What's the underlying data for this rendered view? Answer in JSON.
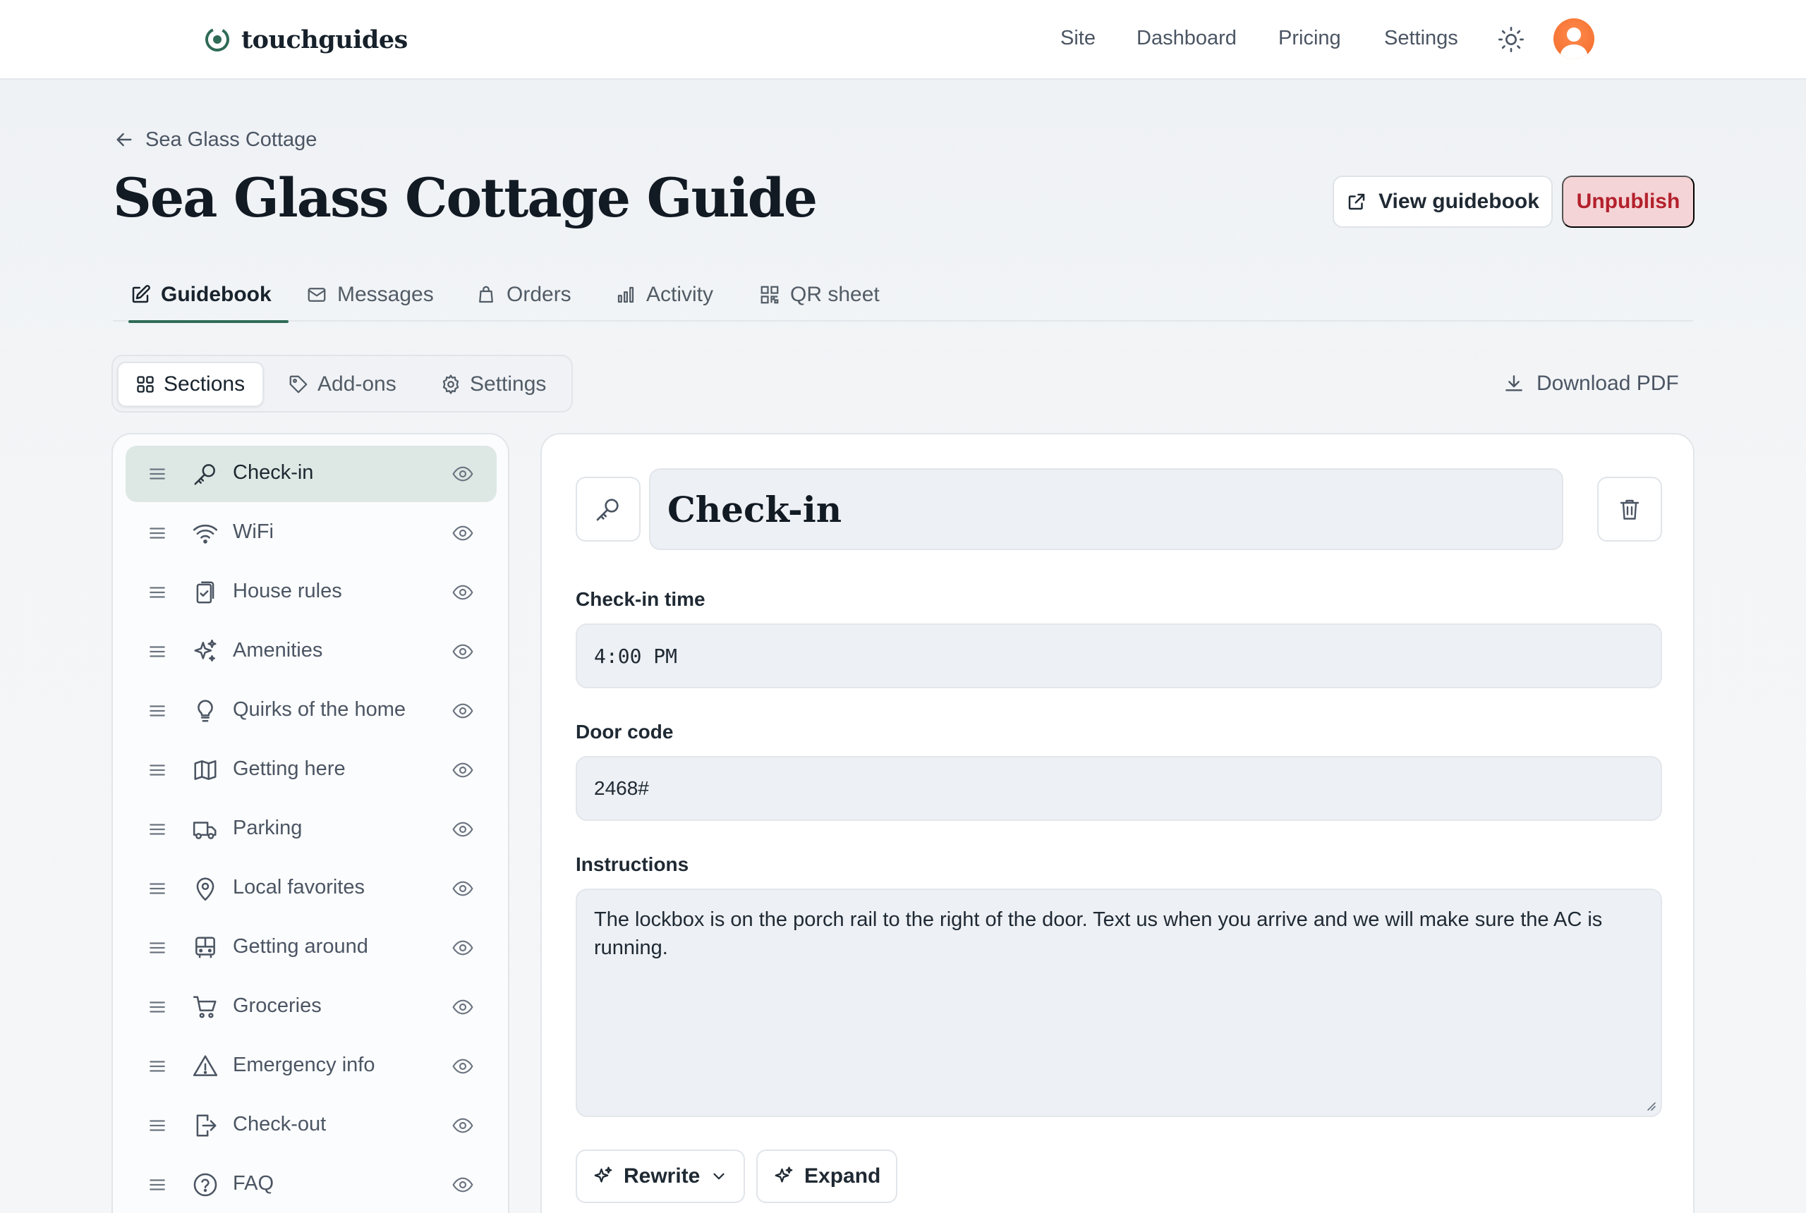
{
  "brand": {
    "name": "touchguides"
  },
  "nav": {
    "site": "Site",
    "dashboard": "Dashboard",
    "pricing": "Pricing",
    "settings": "Settings"
  },
  "breadcrumb": {
    "label": "Sea Glass Cottage"
  },
  "page": {
    "title": "Sea Glass Cottage Guide"
  },
  "actions": {
    "view_guidebook": "View guidebook",
    "unpublish": "Unpublish"
  },
  "tabs": [
    {
      "label": "Guidebook",
      "icon": "edit-icon",
      "active": true
    },
    {
      "label": "Messages",
      "icon": "mail-icon"
    },
    {
      "label": "Orders",
      "icon": "bag-icon"
    },
    {
      "label": "Activity",
      "icon": "bar-chart-icon"
    },
    {
      "label": "QR sheet",
      "icon": "qr-icon"
    }
  ],
  "segments": [
    {
      "label": "Sections",
      "icon": "grid-icon",
      "active": true
    },
    {
      "label": "Add-ons",
      "icon": "tag-icon"
    },
    {
      "label": "Settings",
      "icon": "gear-icon"
    }
  ],
  "download": {
    "label": "Download PDF"
  },
  "sections": [
    {
      "label": "Check-in",
      "icon": "key-icon",
      "active": true
    },
    {
      "label": "WiFi",
      "icon": "wifi-icon"
    },
    {
      "label": "House rules",
      "icon": "clipboard-check-icon"
    },
    {
      "label": "Amenities",
      "icon": "sparkles-icon"
    },
    {
      "label": "Quirks of the home",
      "icon": "lightbulb-icon"
    },
    {
      "label": "Getting here",
      "icon": "map-icon"
    },
    {
      "label": "Parking",
      "icon": "truck-icon"
    },
    {
      "label": "Local favorites",
      "icon": "map-pin-icon"
    },
    {
      "label": "Getting around",
      "icon": "bus-icon"
    },
    {
      "label": "Groceries",
      "icon": "cart-icon"
    },
    {
      "label": "Emergency info",
      "icon": "alert-triangle-icon"
    },
    {
      "label": "Check-out",
      "icon": "log-out-icon"
    },
    {
      "label": "FAQ",
      "icon": "help-circle-icon"
    }
  ],
  "editor": {
    "section_title": "Check-in",
    "fields": {
      "checkin_time": {
        "label": "Check-in time",
        "value": "4:00 PM"
      },
      "door_code": {
        "label": "Door code",
        "value": "2468#"
      },
      "instructions": {
        "label": "Instructions",
        "value": "The lockbox is on the porch rail to the right of the door. Text us when you arrive and we will make sure the AC is running."
      }
    },
    "ai_actions": {
      "rewrite": "Rewrite",
      "expand": "Expand"
    }
  },
  "colors": {
    "accent": "#2f6b58",
    "danger": "#b3202c",
    "danger_bg": "#f4d4d6",
    "active_item_bg": "#dde8e4"
  }
}
